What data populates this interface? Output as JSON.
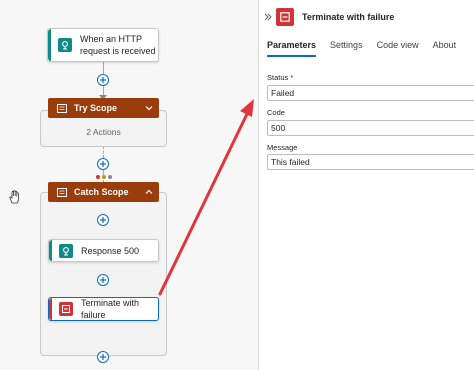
{
  "flow": {
    "trigger_label": "When an HTTP request is received",
    "try_scope": {
      "label": "Try Scope",
      "summary": "2 Actions"
    },
    "catch_scope": {
      "label": "Catch Scope",
      "actions": [
        {
          "label": "Response 500"
        },
        {
          "label": "Terminate with failure"
        }
      ]
    }
  },
  "panel": {
    "title": "Terminate with failure",
    "tabs": [
      {
        "label": "Parameters",
        "active": true
      },
      {
        "label": "Settings"
      },
      {
        "label": "Code view"
      },
      {
        "label": "About"
      }
    ],
    "fields": {
      "status": {
        "label": "Status *",
        "value": "Failed"
      },
      "code": {
        "label": "Code",
        "value": "500"
      },
      "message": {
        "label": "Message",
        "value": "This failed"
      }
    }
  },
  "colors": {
    "scope_brand": "#9b3c0c",
    "http_teal": "#0f8a8a",
    "terminate_red": "#d13438",
    "accent_blue": "#0f6cbd",
    "annotation_arrow": "#e0353b"
  },
  "icons": [
    "http-trigger-icon",
    "scope-icon",
    "chevron-down-icon",
    "chevron-up-icon",
    "response-icon",
    "terminate-icon",
    "add-action-icon",
    "expand-panel-icon",
    "hand-cursor-icon"
  ]
}
